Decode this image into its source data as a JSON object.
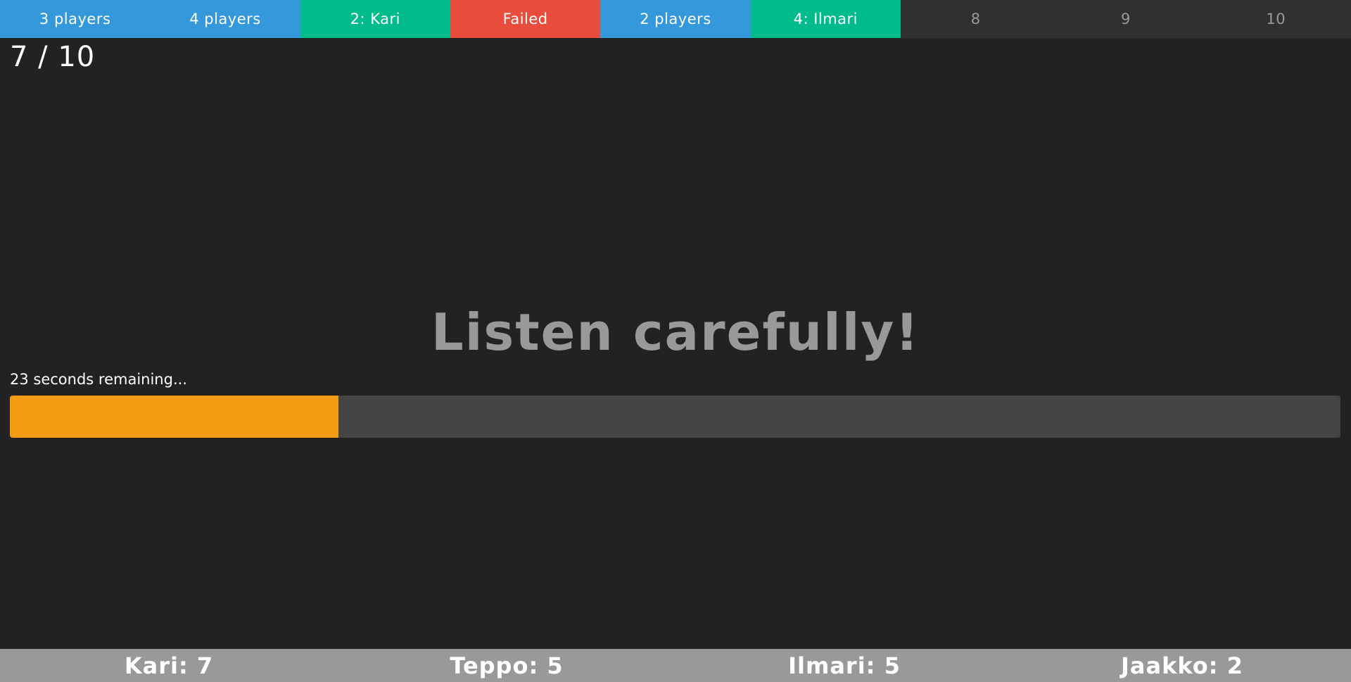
{
  "rounds": [
    {
      "label": "3 players",
      "status": "players"
    },
    {
      "label": "4 players",
      "status": "players"
    },
    {
      "label": "2: Kari",
      "status": "winner"
    },
    {
      "label": "Failed",
      "status": "failed"
    },
    {
      "label": "2 players",
      "status": "players"
    },
    {
      "label": "4: Ilmari",
      "status": "winner"
    },
    {
      "label": "8",
      "status": "pending"
    },
    {
      "label": "9",
      "status": "pending"
    },
    {
      "label": "10",
      "status": "pending"
    }
  ],
  "round_counter": "7 / 10",
  "prompt": "Listen carefully!",
  "timer": {
    "text": "23 seconds remaining...",
    "progress_fraction": 0.247
  },
  "colors": {
    "players": "#3498db",
    "winner": "#00bc8c",
    "failed": "#e74c3c",
    "pending": "#303030",
    "progress": "#f39c12",
    "scoreboard": "#999999"
  },
  "scores": [
    {
      "label": "Kari: 7"
    },
    {
      "label": "Teppo: 5"
    },
    {
      "label": "Ilmari: 5"
    },
    {
      "label": "Jaakko: 2"
    }
  ]
}
